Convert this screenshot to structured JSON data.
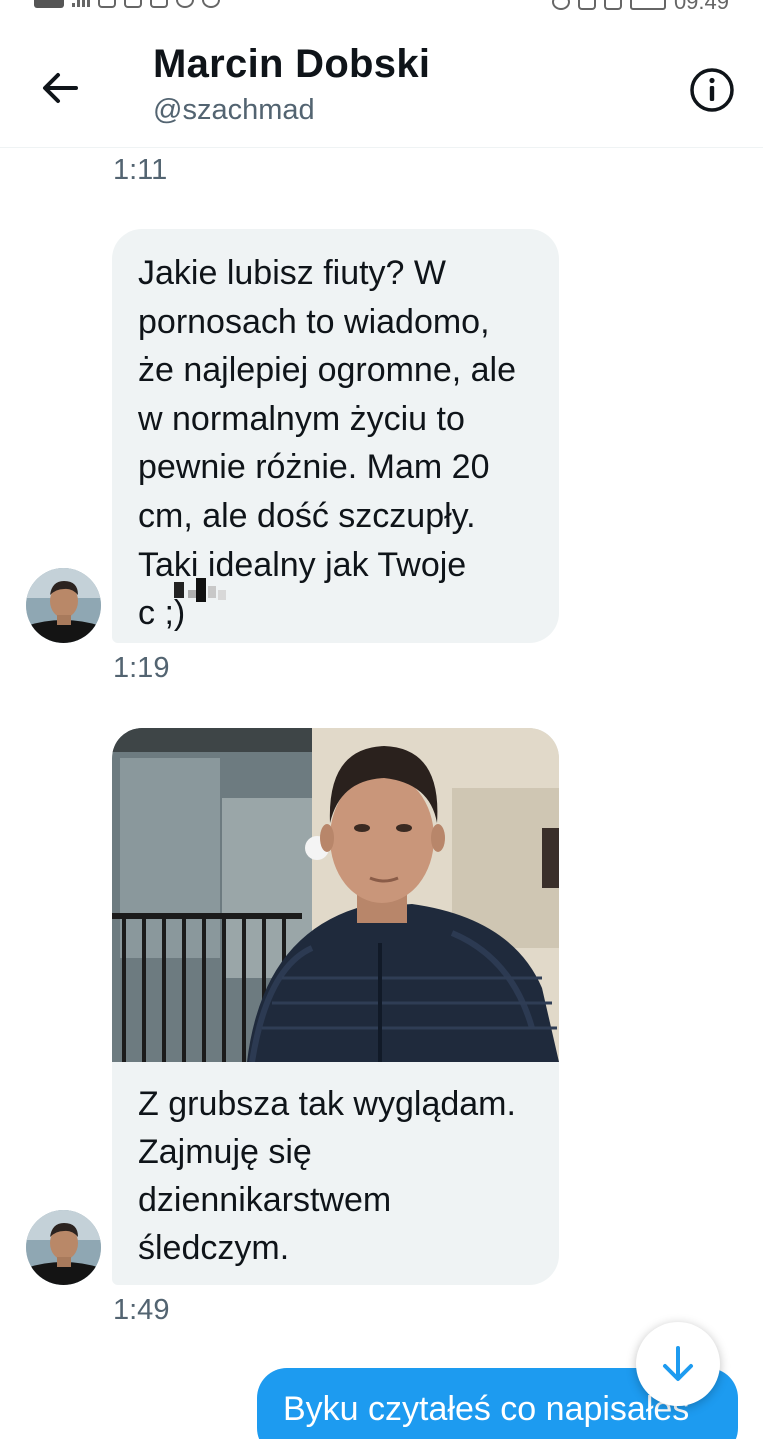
{
  "status_bar": {
    "time": "09:49"
  },
  "header": {
    "title": "Marcin Dobski",
    "handle": "@szachmad",
    "back_icon": "arrow-left-icon",
    "info_icon": "info-circle-icon"
  },
  "messages": [
    {
      "timestamp": "1:11"
    },
    {
      "text": "Jakie lubisz fiuty? W\npornosach to wiadomo,\nże najlepiej ogromne, ale\nw normalnym życiu to\npewnie różnie. Mam 20\ncm, ale dość szczupły.\nTaki idealny jak Twoje\nc        ;)",
      "timestamp": "1:19"
    },
    {
      "image": "selfie-photo",
      "text": "Z grubsza tak wyglądam.\nZajmuję się\ndziennikarstwem\nśledczym.",
      "timestamp": "1:49"
    },
    {
      "sent_text": "Byku czytałeś co napisałeś"
    }
  ],
  "colors": {
    "accent": "#1d9bf0",
    "bubble_received": "#eff3f4",
    "secondary_text": "#536471"
  }
}
